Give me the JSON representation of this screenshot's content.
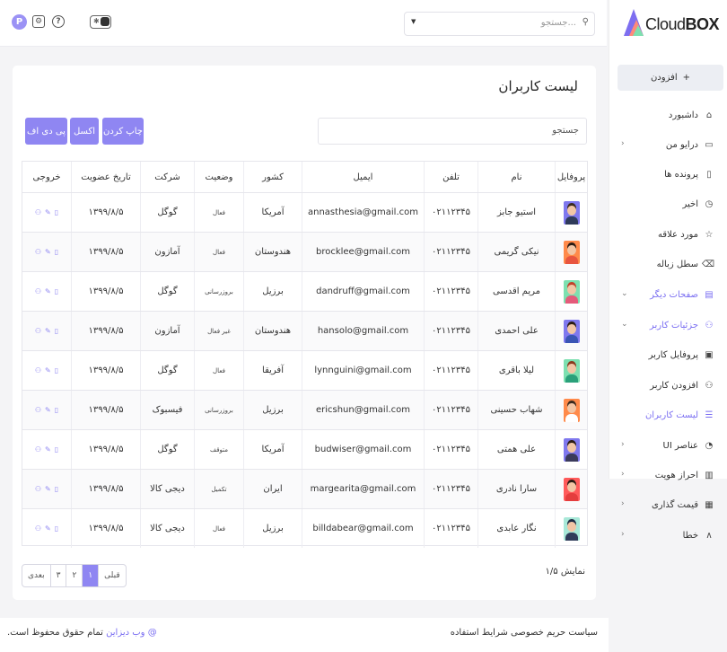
{
  "app": {
    "logo": "CloudBOX",
    "logo_light": "Cloud",
    "logo_bold": "BOX",
    "accent": "#8f86f2"
  },
  "topbar": {
    "search_placeholder": "جستجو...",
    "avatar_letter": "P"
  },
  "sidebar": {
    "add_label": "افزودن",
    "items": [
      {
        "label": "داشبورد",
        "icon": "home-icon",
        "chevron": false,
        "active": false
      },
      {
        "label": "درایو من",
        "icon": "hdd-icon",
        "chevron": true,
        "active": false
      },
      {
        "label": "پرونده ها",
        "icon": "file-icon",
        "chevron": false,
        "active": false
      },
      {
        "label": "اخیر",
        "icon": "clock-icon",
        "chevron": false,
        "active": false
      },
      {
        "label": "مورد علاقه",
        "icon": "star-icon",
        "chevron": false,
        "active": false
      },
      {
        "label": "سطل زباله",
        "icon": "trash-icon",
        "chevron": false,
        "active": false
      },
      {
        "label": "صفحات دیگر",
        "icon": "pages-icon",
        "chevron": true,
        "active": true
      },
      {
        "label": "جزئیات کاربر",
        "icon": "user-icon",
        "chevron": true,
        "active": true
      },
      {
        "label": "پروفایل کاربر",
        "icon": "id-card-icon",
        "chevron": false,
        "active": false
      },
      {
        "label": "افزودن کاربر",
        "icon": "user-plus-icon",
        "chevron": false,
        "active": false
      },
      {
        "label": "لیست کاربران",
        "icon": "list-icon",
        "chevron": false,
        "active": true
      },
      {
        "label": "عناصر UI",
        "icon": "ui-icon",
        "chevron": true,
        "active": false
      },
      {
        "label": "احراز هویت",
        "icon": "auth-icon",
        "chevron": true,
        "active": false
      },
      {
        "label": "قیمت گذاری",
        "icon": "price-icon",
        "chevron": true,
        "active": false
      },
      {
        "label": "خطا",
        "icon": "error-icon",
        "chevron": true,
        "active": false
      }
    ]
  },
  "page": {
    "title": "لیست کاربران",
    "buttons": {
      "print": "چاپ کردن",
      "excel": "اکسل",
      "pdf": "پی دی اف"
    },
    "search_placeholder": "جستجو",
    "columns": [
      "پروفایل",
      "نام",
      "تلفن",
      "ایمیل",
      "کشور",
      "وضعیت",
      "شرکت",
      "تاریخ عضویت",
      "خروجی"
    ],
    "rows": [
      {
        "name": "استیو جابز",
        "phone": "۰۲۱۱۲۳۴۵",
        "email": "annasthesia@gmail.com",
        "country": "آمریکا",
        "status": "فعال",
        "company": "گوگل",
        "date": "۱۳۹۹/۸/۵",
        "hair": "#3a2a1e",
        "shirt": "#2f3b5a",
        "bg": "#7f78ee"
      },
      {
        "name": "نیکی گریمی",
        "phone": "۰۲۱۱۲۳۴۵",
        "email": "brocklee@gmail.com",
        "country": "هندوستان",
        "status": "فعال",
        "company": "آمازون",
        "date": "۱۳۹۹/۸/۵",
        "hair": "#2b1c14",
        "shirt": "#e8553f",
        "bg": "#ff8a4a"
      },
      {
        "name": "مریم اقدسی",
        "phone": "۰۲۱۱۲۳۴۵",
        "email": "dandruff@gmail.com",
        "country": "برزیل",
        "status": "بروزرسانی",
        "company": "گوگل",
        "date": "۱۳۹۹/۸/۵",
        "hair": "#c2412b",
        "shirt": "#e45b7a",
        "bg": "#7de0b0"
      },
      {
        "name": "علی احمدی",
        "phone": "۰۲۱۱۲۳۴۵",
        "email": "hansolo@gmail.com",
        "country": "هندوستان",
        "status": "غیر فعال",
        "company": "آمازون",
        "date": "۱۳۹۹/۸/۵",
        "hair": "#2b1c14",
        "shirt": "#3a55b4",
        "bg": "#7f78ee"
      },
      {
        "name": "لیلا باقری",
        "phone": "۰۲۱۱۲۳۴۵",
        "email": "lynnguini@gmail.com",
        "country": "آفریقا",
        "status": "فعال",
        "company": "گوگل",
        "date": "۱۳۹۹/۸/۵",
        "hair": "#8a3a1e",
        "shirt": "#2aa07a",
        "bg": "#7de0b0"
      },
      {
        "name": "شهاب حسینی",
        "phone": "۰۲۱۱۲۳۴۵",
        "email": "ericshun@gmail.com",
        "country": "برزیل",
        "status": "بروزرسانی",
        "company": "فیسبوک",
        "date": "۱۳۹۹/۸/۵",
        "hair": "#3a2a1e",
        "shirt": "#ffffff",
        "bg": "#ff8a4a"
      },
      {
        "name": "علی همتی",
        "phone": "۰۲۱۱۲۳۴۵",
        "email": "budwiser@gmail.com",
        "country": "آمریکا",
        "status": "متوقف",
        "company": "گوگل",
        "date": "۱۳۹۹/۸/۵",
        "hair": "#2b1c14",
        "shirt": "#3b3b5c",
        "bg": "#7f78ee"
      },
      {
        "name": "سارا نادری",
        "phone": "۰۲۱۱۲۳۴۵",
        "email": "margearita@gmail.com",
        "country": "ایران",
        "status": "تکمیل",
        "company": "دیجی کالا",
        "date": "۱۳۹۹/۸/۵",
        "hair": "#2b1c14",
        "shirt": "#e43d3d",
        "bg": "#ff5a5a"
      },
      {
        "name": "نگار عابدی",
        "phone": "۰۲۱۱۲۳۴۵",
        "email": "billdabear@gmail.com",
        "country": "برزیل",
        "status": "فعال",
        "company": "دیجی کالا",
        "date": "۱۳۹۹/۸/۵",
        "hair": "#1f2b44",
        "shirt": "#2f3b5a",
        "bg": "#a8e8d8"
      }
    ],
    "info": "نمایش ۱/۵",
    "pager": [
      "بعدی",
      "۳",
      "۲",
      "۱",
      "قبلی"
    ],
    "pager_active": "۱"
  },
  "footer": {
    "right": "سیاست حریم خصوصی شرایط استفاده",
    "left_brand": "وب دیزاین",
    "left_rest": "تمام حقوق محفوظ است.",
    "left_symbol": "@"
  }
}
